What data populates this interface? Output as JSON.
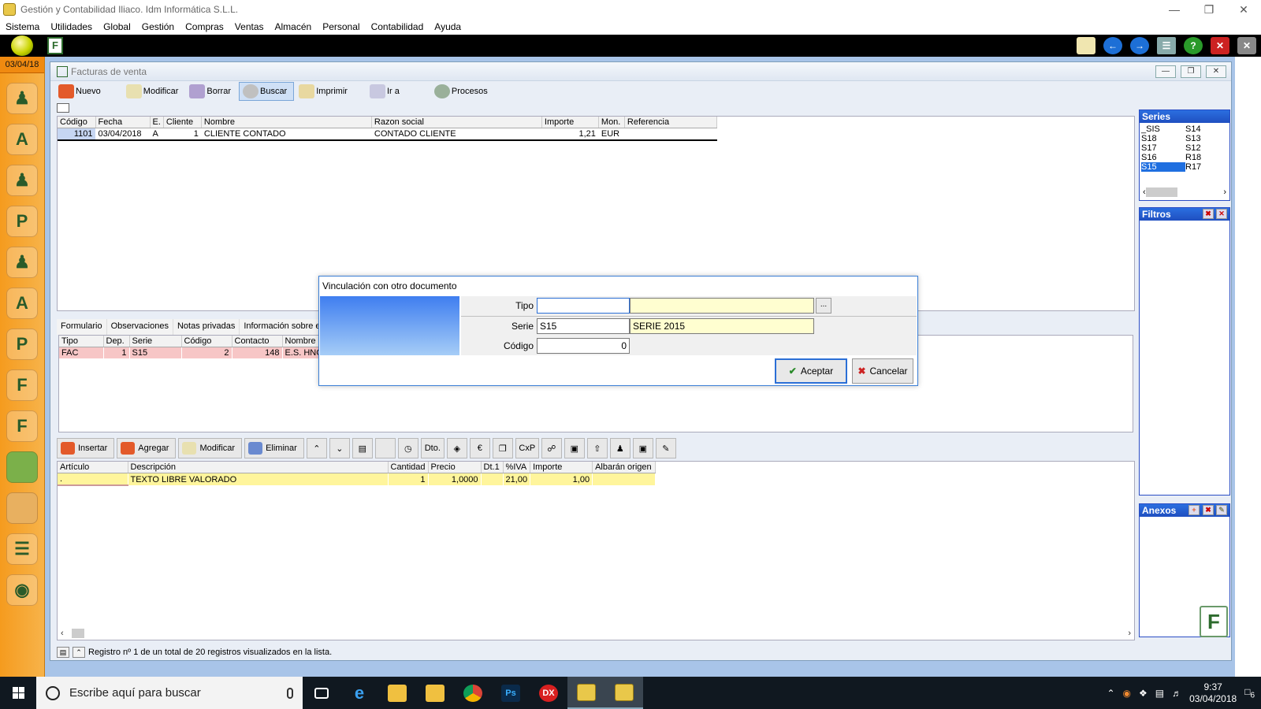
{
  "window": {
    "title": "Gestión y Contabilidad Iliaco. Idm Informática S.L.L."
  },
  "menu": [
    "Sistema",
    "Utilidades",
    "Global",
    "Gestión",
    "Compras",
    "Ventas",
    "Almacén",
    "Personal",
    "Contabilidad",
    "Ayuda"
  ],
  "sidebar": {
    "date": "03/04/18",
    "icons": [
      "users-icon",
      "abc-icon",
      "person-icon",
      "person-p-icon",
      "group-icon",
      "person-a-icon",
      "p-icon",
      "f-icon",
      "fc-icon",
      "bag-green-icon",
      "bag-orange-icon",
      "list-icon",
      "disc-icon"
    ]
  },
  "child": {
    "title": "Facturas de venta",
    "actions": [
      "Nuevo",
      "Modificar",
      "Borrar",
      "Buscar",
      "Imprimir",
      "Ir a",
      "Procesos"
    ],
    "grid1": {
      "headers": [
        "Código",
        "Fecha",
        "E.",
        "Cliente",
        "Nombre",
        "Razon social",
        "Importe",
        "Mon.",
        "Referencia"
      ],
      "rows": [
        [
          "1101",
          "03/04/2018",
          "A",
          "1",
          "CLIENTE CONTADO",
          "CONTADO CLIENTE",
          "1,21",
          "EUR",
          ""
        ]
      ]
    },
    "series": {
      "title": "Series",
      "items": [
        "_SIS",
        "S14",
        "S18",
        "S13",
        "S17",
        "S12",
        "S16",
        "R18",
        "S15",
        "R17"
      ],
      "selected": "S15"
    },
    "filtros": {
      "title": "Filtros"
    },
    "anexos": {
      "title": "Anexos"
    },
    "tabs": [
      "Formulario",
      "Observaciones",
      "Notas privadas",
      "Información sobre el det"
    ],
    "grid2": {
      "headers": [
        "Tipo",
        "Dep.",
        "Serie",
        "Código",
        "Contacto",
        "Nombre"
      ],
      "rows": [
        [
          "FAC",
          "1",
          "S15",
          "2",
          "148",
          "E.S. HNOS"
        ]
      ]
    },
    "line_buttons": [
      "Insertar",
      "Agregar",
      "Modificar",
      "Eliminar"
    ],
    "small_buttons": [
      "Dto.",
      "CxP"
    ],
    "grid3": {
      "headers": [
        "Artículo",
        "Descripción",
        "Cantidad",
        "Precio",
        "Dt.1",
        "%IVA",
        "Importe",
        "Albarán origen"
      ],
      "rows": [
        [
          ".",
          "TEXTO LIBRE VALORADO",
          "1",
          "1,0000",
          "",
          "21,00",
          "1,00",
          ""
        ]
      ]
    },
    "status": "Registro nº 1 de un total de 20 registros visualizados en la lista."
  },
  "dialog": {
    "title": "Vinculación con otro documento",
    "tipo_label": "Tipo",
    "tipo_value": "",
    "tipo_desc": "",
    "serie_label": "Serie",
    "serie_value": "S15",
    "serie_desc": "SERIE 2015",
    "codigo_label": "Código",
    "codigo_value": "0",
    "ellipsis": "...",
    "accept": "Aceptar",
    "cancel": "Cancelar"
  },
  "taskbar": {
    "search_placeholder": "Escribe aquí para buscar",
    "time": "9:37",
    "date": "03/04/2018",
    "notifications": "6"
  }
}
